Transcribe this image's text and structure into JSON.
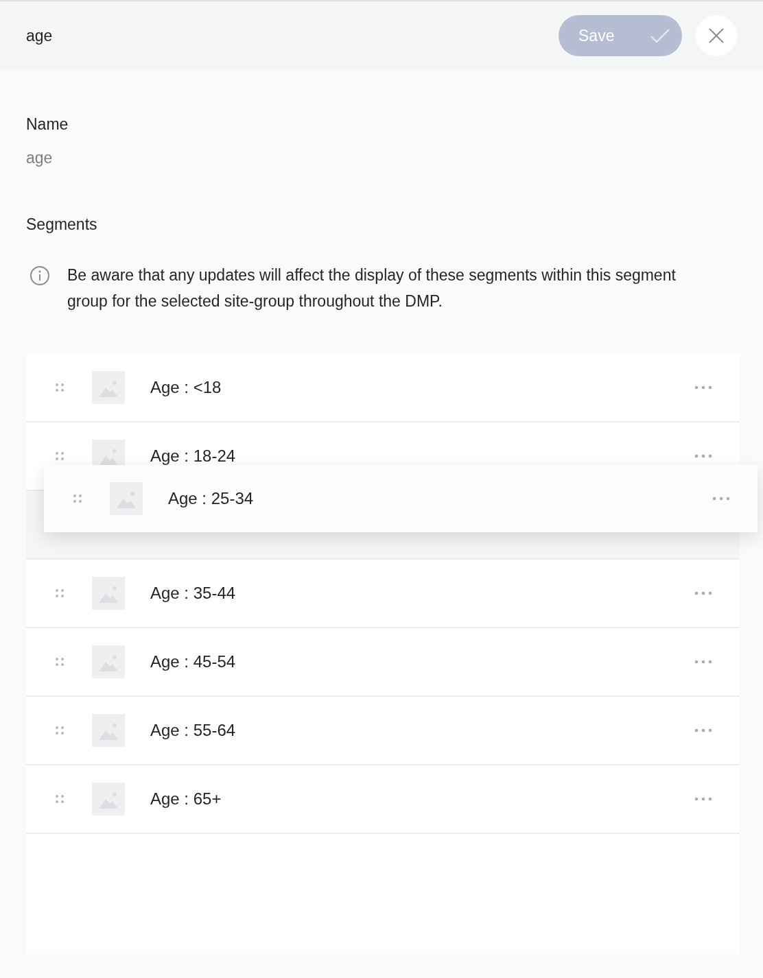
{
  "header": {
    "title": "age",
    "save_button": {
      "label": "Save",
      "disabled": true
    }
  },
  "name_field": {
    "label": "Name",
    "value": "age"
  },
  "segments_heading": "Segments",
  "notice": "Be aware that any updates will affect the display of these segments within this segment group for the selected site-group throughout the DMP.",
  "segments": [
    {
      "label": "Age : <18",
      "dragging": false
    },
    {
      "label": "Age : 18-24",
      "dragging": false
    },
    {
      "label": "Age : 25-34",
      "dragging": true
    },
    {
      "label": "Age : 35-44",
      "dragging": false
    },
    {
      "label": "Age : 45-54",
      "dragging": false
    },
    {
      "label": "Age : 55-64",
      "dragging": false
    },
    {
      "label": "Age : 65+",
      "dragging": false
    }
  ]
}
